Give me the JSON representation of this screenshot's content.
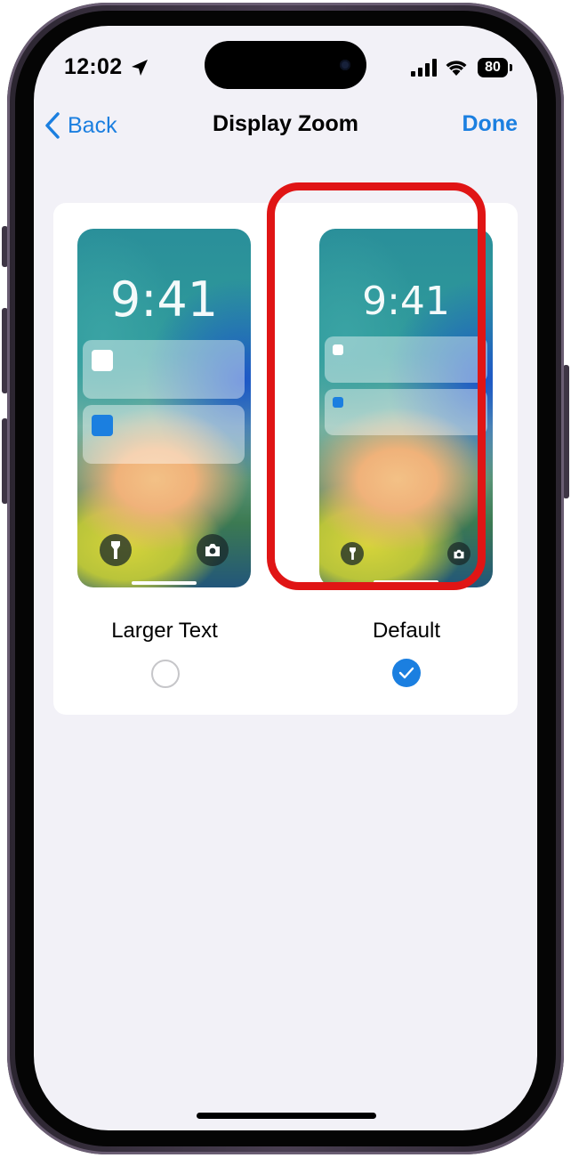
{
  "status_bar": {
    "time": "12:02",
    "battery": "80"
  },
  "nav": {
    "back_label": "Back",
    "title": "Display Zoom",
    "done_label": "Done"
  },
  "options": [
    {
      "label": "Larger Text",
      "preview_time": "9:41",
      "selected": false
    },
    {
      "label": "Default",
      "preview_time": "9:41",
      "selected": true
    }
  ],
  "colors": {
    "accent": "#1b7fe0",
    "highlight": "#e01515",
    "background": "#f2f1f7"
  }
}
